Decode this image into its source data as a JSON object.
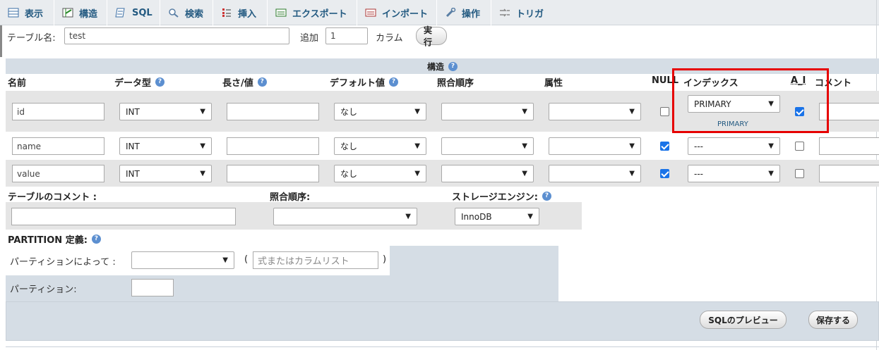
{
  "tabs": [
    {
      "label": "表示",
      "icon": "browse-icon"
    },
    {
      "label": "構造",
      "icon": "structure-icon"
    },
    {
      "label": "SQL",
      "icon": "sql-icon"
    },
    {
      "label": "検索",
      "icon": "search-icon"
    },
    {
      "label": "挿入",
      "icon": "insert-icon"
    },
    {
      "label": "エクスポート",
      "icon": "export-icon"
    },
    {
      "label": "インポート",
      "icon": "import-icon"
    },
    {
      "label": "操作",
      "icon": "operations-icon"
    },
    {
      "label": "トリガ",
      "icon": "triggers-icon"
    }
  ],
  "topbar": {
    "table_name_label": "テーブル名:",
    "table_name_value": "test",
    "add_label": "追加",
    "add_value": "1",
    "column_label": "カラム",
    "execute_button": "実行"
  },
  "structure": {
    "title": "構造",
    "headers": {
      "name": "名前",
      "type": "データ型",
      "length": "長さ/値",
      "default": "デフォルト値",
      "collation": "照合順序",
      "attributes": "属性",
      "null": "NULL",
      "index": "インデックス",
      "ai": "A_I",
      "comment": "コメント"
    },
    "rows": [
      {
        "name": "id",
        "type": "INT",
        "length": "",
        "default": "なし",
        "collation": "",
        "attribute": "",
        "null": false,
        "index": "PRIMARY",
        "index_note": "PRIMARY",
        "ai": true
      },
      {
        "name": "name",
        "type": "INT",
        "length": "",
        "default": "なし",
        "collation": "",
        "attribute": "",
        "null": true,
        "index": "---",
        "index_note": "",
        "ai": false
      },
      {
        "name": "value",
        "type": "INT",
        "length": "",
        "default": "なし",
        "collation": "",
        "attribute": "",
        "null": true,
        "index": "---",
        "index_note": "",
        "ai": false
      }
    ]
  },
  "table_options": {
    "comment_label": "テーブルのコメント :",
    "collation_label": "照合順序:",
    "engine_label": "ストレージエンジン:",
    "engine_value": "InnoDB"
  },
  "partition": {
    "title": "PARTITION 定義:",
    "by_label": "パーティションによって :",
    "expr_placeholder": "式またはカラムリスト",
    "open_paren": "(",
    "close_paren": ")",
    "partitions_label": "パーティション:"
  },
  "footer": {
    "preview_button": "SQLのプレビュー",
    "save_button": "保存する"
  },
  "colors": {
    "accent": "#235a81",
    "highlight": "#e60000",
    "checkbox": "#1a73e8"
  }
}
